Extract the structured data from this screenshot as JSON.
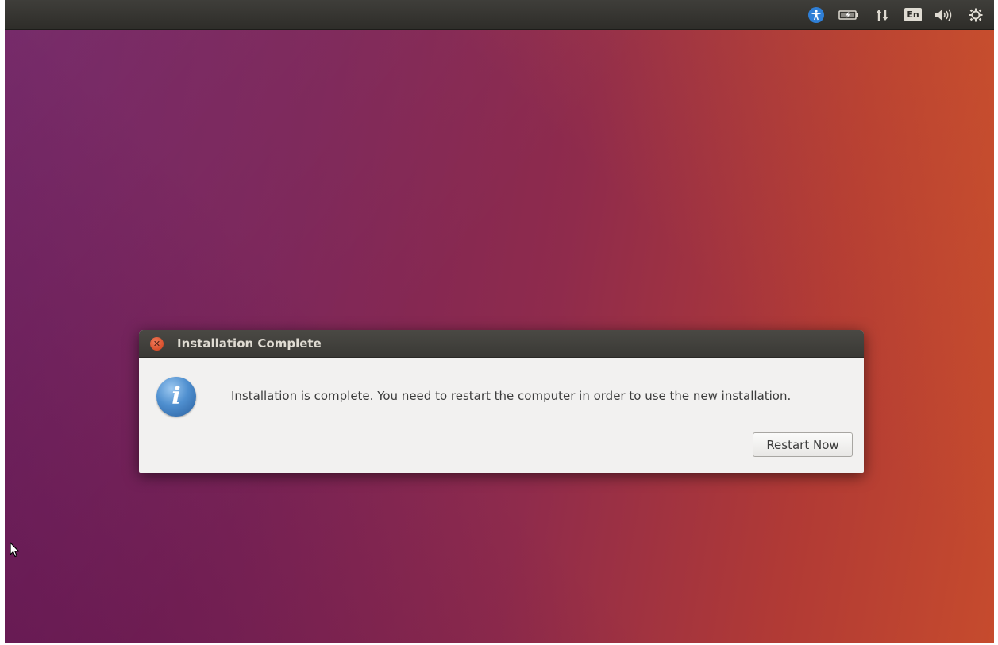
{
  "top_panel": {
    "indicators": [
      {
        "icon": "accessibility-icon"
      },
      {
        "icon": "battery-icon"
      },
      {
        "icon": "network-icon"
      },
      {
        "icon": "keyboard-layout-icon",
        "label": "En"
      },
      {
        "icon": "volume-icon"
      },
      {
        "icon": "gear-icon"
      }
    ]
  },
  "dialog": {
    "title": "Installation Complete",
    "icon": "info-icon",
    "message": "Installation is complete. You need to restart the computer in order to use the new installation.",
    "restart_button": "Restart Now"
  },
  "colors": {
    "panel": "#3a3935",
    "dialog_background": "#f2f1f0",
    "close_button": "#e0603a",
    "accessibility_accent": "#2f7fd6"
  }
}
